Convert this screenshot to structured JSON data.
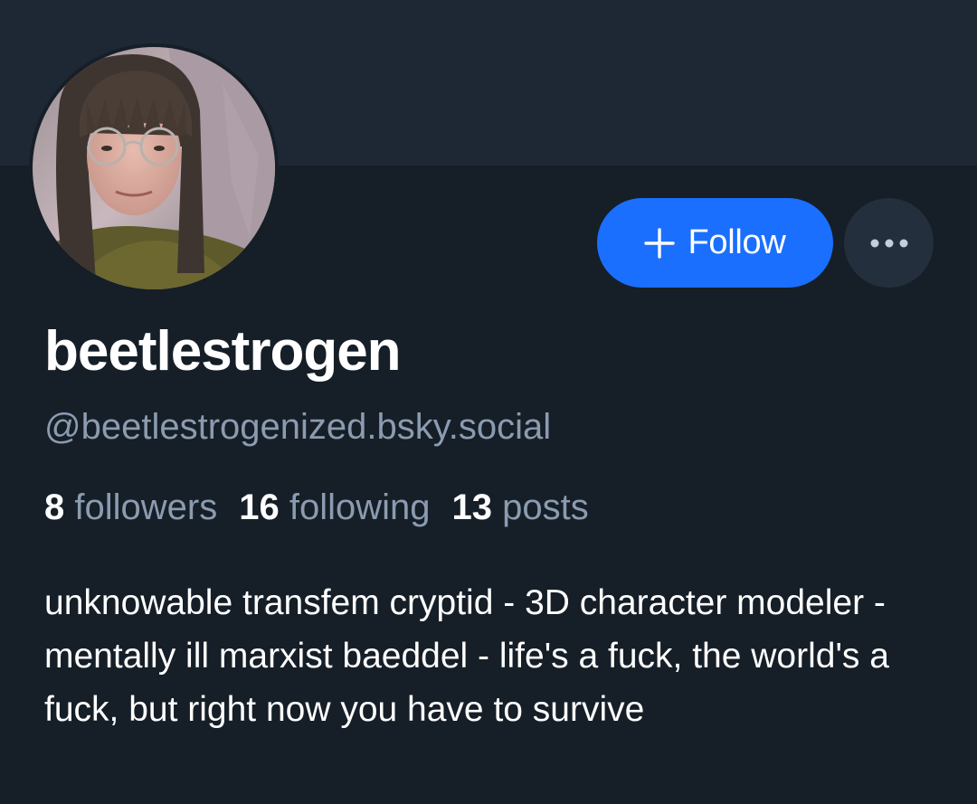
{
  "profile": {
    "display_name": "beetlestrogen",
    "handle": "@beetlestrogenized.bsky.social",
    "bio": "unknowable transfem cryptid - 3D character modeler - mentally ill marxist baeddel - life's a fuck, the world's a fuck, but right now you have to survive",
    "avatar_icon": "profile-photo"
  },
  "actions": {
    "follow_label": "Follow",
    "follow_icon": "plus-icon",
    "more_icon": "ellipsis-icon"
  },
  "stats": {
    "followers_count": "8",
    "followers_label": "followers",
    "following_count": "16",
    "following_label": "following",
    "posts_count": "13",
    "posts_label": "posts"
  },
  "colors": {
    "background": "#161e27",
    "banner": "#1e2835",
    "accent": "#1a6fff",
    "secondary_text": "#8b9bb0"
  }
}
